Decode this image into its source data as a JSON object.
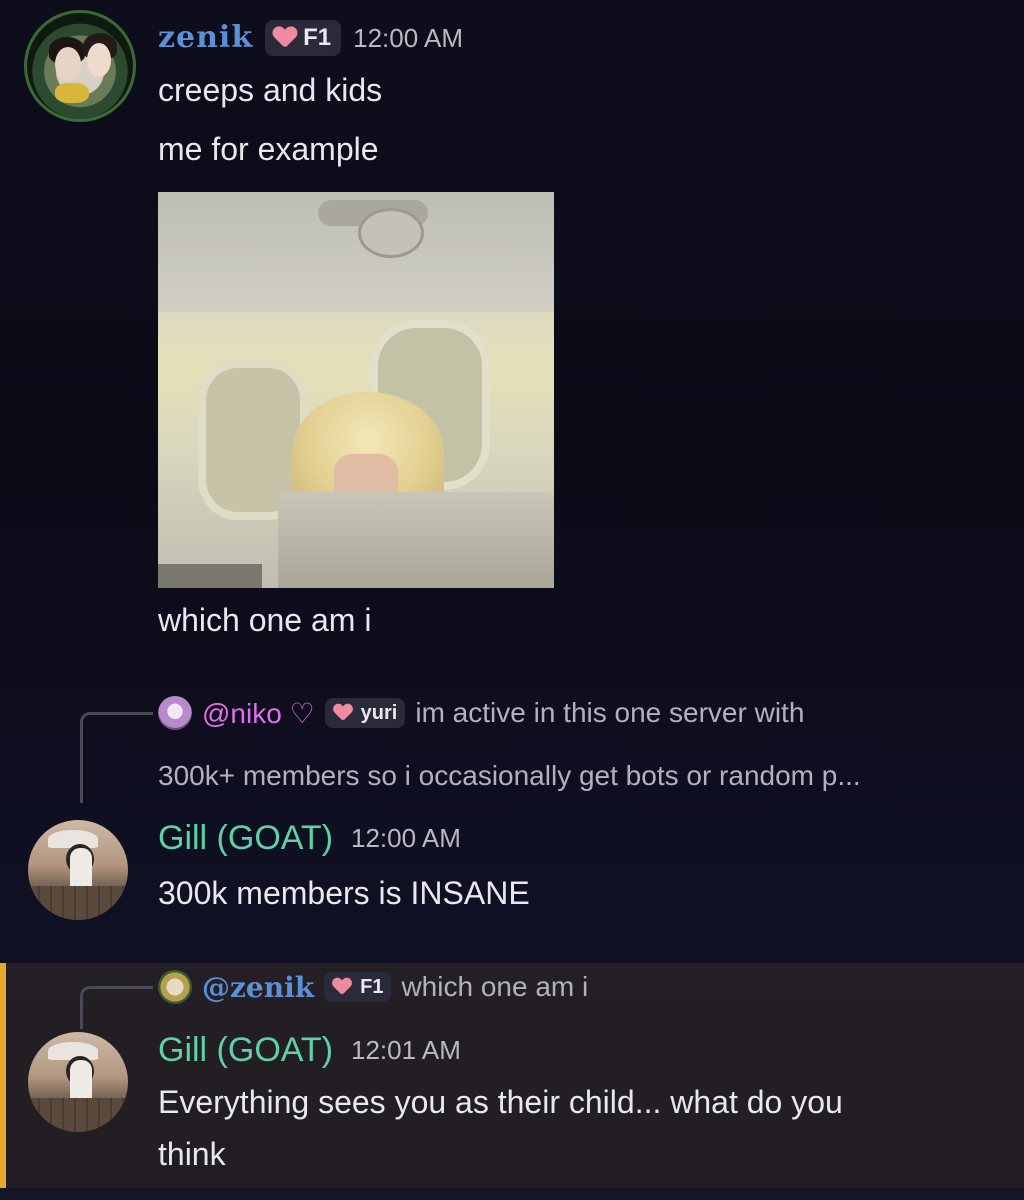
{
  "messages": [
    {
      "author": "zenik",
      "tag": "F1",
      "time": "12:00 AM",
      "lines": [
        "creeps and kids",
        "me for example"
      ],
      "after_image": "which one am i"
    },
    {
      "reply": {
        "name": "@niko ♡",
        "tag": "yuri",
        "text_line1": "im active in this one server with",
        "text_line2": "300k+ members so i occasionally get bots or random p..."
      },
      "author": "Gill (GOAT)",
      "time": "12:00 AM",
      "lines": [
        "300k members is INSANE"
      ]
    },
    {
      "reply": {
        "name": "@zenik",
        "tag": "F1",
        "text": "which one am i"
      },
      "author": "Gill (GOAT)",
      "time": "12:01 AM",
      "lines": [
        "Everything sees you as their child... what do you",
        "think"
      ]
    }
  ],
  "colors": {
    "zenik_name": "#5b8fd6",
    "gill_name": "#5fd1a6",
    "niko_name": "#e070e8",
    "highlight_bar": "#e7a92a"
  },
  "icons": {
    "tag_icon": "heart-icon"
  }
}
